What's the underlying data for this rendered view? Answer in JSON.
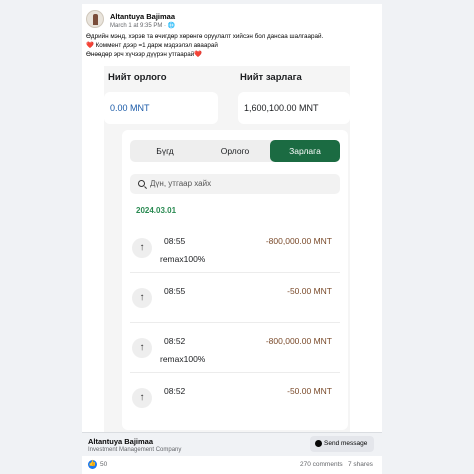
{
  "post": {
    "author": "Altantuya Bajimaa",
    "meta": "March 1 at 9:35 PM · 🌐",
    "caption": [
      "Өдрийн мэнд, хэрэв та өчигдөр хөрөнгө оруулалт хийсэн бол дансаа шалгаарай.",
      "❤️ Коммент дээр =1 дарж мэдээлэл аваарай",
      "Өнөөдөр эрч хүчээр дүүрэн утгаарай❤️"
    ]
  },
  "app": {
    "income_label": "Нийт орлого",
    "expense_label": "Нийт зарлага",
    "income_value": "0.00 MNT",
    "expense_value": "1,600,100.00 MNT",
    "tabs": [
      "Бүгд",
      "Орлого",
      "Зарлага"
    ],
    "active_tab": "Зарлага",
    "search_placeholder": "Дүн, утгаар хайх",
    "date": "2024.03.01",
    "transactions": [
      {
        "icon": "↑",
        "time": "08:55",
        "amount": "-800,000.00 MNT",
        "note": "remax100%"
      },
      {
        "icon": "↑",
        "time": "08:55",
        "amount": "-50.00 MNT",
        "note": ""
      },
      {
        "icon": "↑",
        "time": "08:52",
        "amount": "-800,000.00 MNT",
        "note": "remax100%"
      },
      {
        "icon": "↑",
        "time": "08:52",
        "amount": "-50.00 MNT",
        "note": ""
      }
    ]
  },
  "footer": {
    "company": "Altantuya Bajimaa",
    "subtitle": "Investment Management Company",
    "send_label": "Send message"
  },
  "reactions": {
    "likes": "50",
    "comments": "270 comments",
    "shares": "7 shares"
  },
  "colors": {
    "accent": "#1b6b42",
    "date": "#2a8a52",
    "amount": "#7a4a2a",
    "facebook_blue": "#1877f2"
  }
}
